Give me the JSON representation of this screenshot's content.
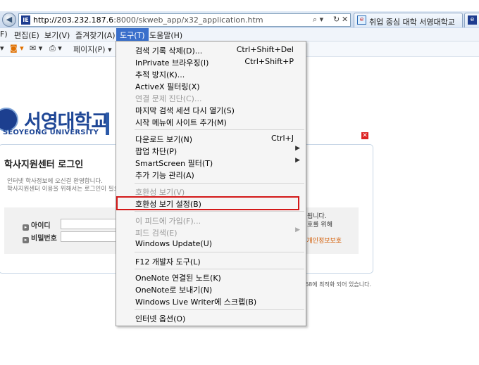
{
  "browser": {
    "url_host": "http://203.232.187.6",
    "url_rest": ":8000/skweb_app/x32_application.htm",
    "favicon_text": "IE",
    "addr_controls": [
      "⌕ ▾",
      "↻",
      "✕"
    ],
    "tabs": [
      {
        "title": "취업 중심 대학 서영대학교",
        "icon": "ie-icon"
      },
      {
        "title": "",
        "icon": "ie-icon"
      }
    ],
    "tab_close_glyph": "✕"
  },
  "menubar": {
    "items": [
      "F)",
      "편집(E)",
      "보기(V)",
      "즐겨찾기(A)",
      "도구(T)",
      "도움말(H)"
    ],
    "active_index": 4
  },
  "cmdbar": {
    "page_label": "페이지(P) ▾",
    "icons": [
      "feeds-icon",
      "mail-icon",
      "print-icon"
    ]
  },
  "page": {
    "logo_ko": "서영대학교",
    "logo_en": "SEOYEONG UNIVERSITY",
    "close_glyph": "✕",
    "login_title": "학사지원센터 로그인",
    "login_sub1": "인터넷 학사정보에 오신걸 환영합니다.",
    "login_sub2": "학사지원센터 이용을 위해서는 로그인이 필요",
    "id_label": "아이디",
    "pw_label": "비밀번호",
    "right_text1": "됩니다.",
    "right_text2": "호를 위해",
    "privacy_link": "▸ 개인정보보호",
    "footer_note": "768에 최적화 되어 있습니다."
  },
  "tools_menu": {
    "items": [
      {
        "label": "검색 기록 삭제(D)...",
        "shortcut": "Ctrl+Shift+Del",
        "disabled": false
      },
      {
        "label": "InPrivate 브라우징(I)",
        "shortcut": "Ctrl+Shift+P",
        "disabled": false
      },
      {
        "label": "추적 방지(K)...",
        "shortcut": "",
        "disabled": false
      },
      {
        "label": "ActiveX 필터링(X)",
        "shortcut": "",
        "disabled": false
      },
      {
        "label": "연결 문제 진단(C)...",
        "shortcut": "",
        "disabled": true
      },
      {
        "label": "마지막 검색 세션 다시 열기(S)",
        "shortcut": "",
        "disabled": false
      },
      {
        "label": "시작 메뉴에 사이트 추가(M)",
        "shortcut": "",
        "disabled": false
      },
      {
        "label": "다운로드 보기(N)",
        "shortcut": "Ctrl+J",
        "disabled": false
      },
      {
        "label": "팝업 차단(P)",
        "shortcut": "",
        "submenu": true,
        "disabled": false
      },
      {
        "label": "SmartScreen 필터(T)",
        "shortcut": "",
        "submenu": true,
        "disabled": false
      },
      {
        "label": "추가 기능 관리(A)",
        "shortcut": "",
        "disabled": false
      },
      {
        "label": "호환성 보기(V)",
        "shortcut": "",
        "disabled": true
      },
      {
        "label": "호환성 보기 설정(B)",
        "shortcut": "",
        "disabled": false,
        "highlighted": true
      },
      {
        "label": "이 피드에 가입(F)...",
        "shortcut": "",
        "disabled": true
      },
      {
        "label": "피드 검색(E)",
        "shortcut": "",
        "submenu": true,
        "disabled": true
      },
      {
        "label": "Windows Update(U)",
        "shortcut": "",
        "disabled": false
      },
      {
        "label": "F12 개발자 도구(L)",
        "shortcut": "",
        "disabled": false
      },
      {
        "label": "OneNote 연결된 노트(K)",
        "shortcut": "",
        "disabled": false
      },
      {
        "label": "OneNote로 보내기(N)",
        "shortcut": "",
        "disabled": false
      },
      {
        "label": "Windows Live Writer에 스크랩(B)",
        "shortcut": "",
        "disabled": false
      },
      {
        "label": "인터넷 옵션(O)",
        "shortcut": "",
        "disabled": false
      }
    ],
    "submenu_glyph": "▶",
    "highlight_color": "#d31818"
  }
}
